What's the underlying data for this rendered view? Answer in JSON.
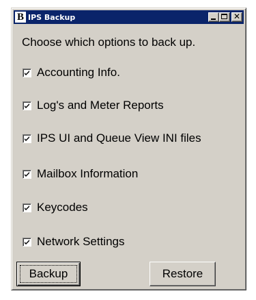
{
  "window": {
    "title": "IPS Backup",
    "logo_letter": "B"
  },
  "icons": {
    "app": "app-logo-icon",
    "minimize": "minimize-icon",
    "maximize": "maximize-icon",
    "close": "close-icon",
    "check": "checkmark-icon"
  },
  "prompt": "Choose which options to back up.",
  "options": [
    {
      "label": "Accounting Info.",
      "checked": true
    },
    {
      "label": "Log's and Meter Reports",
      "checked": true
    },
    {
      "label": "IPS UI and Queue View INI files",
      "checked": true
    },
    {
      "label": "Mailbox Information",
      "checked": true
    },
    {
      "label": "Keycodes",
      "checked": true
    },
    {
      "label": "Network Settings",
      "checked": true
    }
  ],
  "buttons": {
    "backup_label": "Backup",
    "restore_label": "Restore",
    "close_glyph": "✕"
  },
  "colors": {
    "titlebar": "#0a246a",
    "face": "#d4d0c8"
  }
}
